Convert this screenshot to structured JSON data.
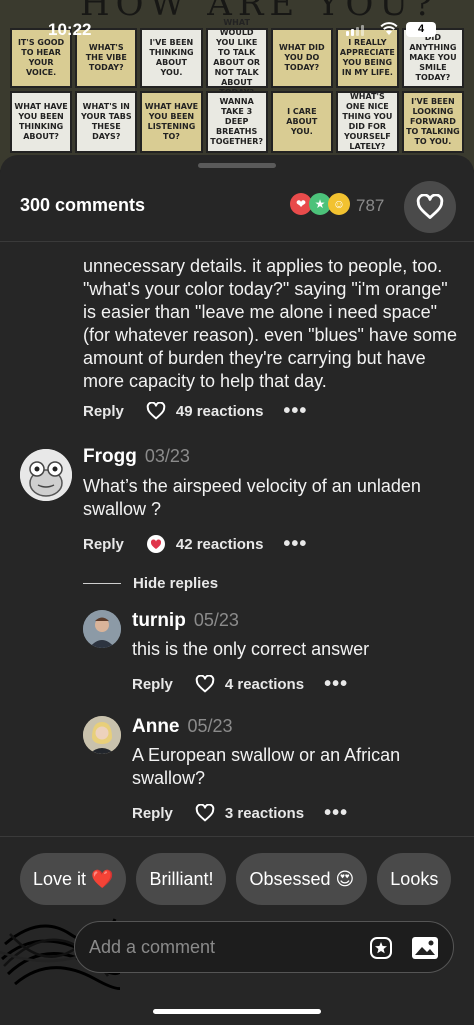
{
  "status_bar": {
    "time": "10:22",
    "battery": "4"
  },
  "background_image": {
    "banner": "HOW ARE YOU?",
    "cards_row1": [
      "IT'S GOOD TO HEAR YOUR VOICE.",
      "WHAT'S THE VIBE TODAY?",
      "I'VE BEEN THINKING ABOUT YOU.",
      "WHAT WOULD YOU LIKE TO TALK ABOUT OR NOT TALK ABOUT TODAY?",
      "WHAT DID YOU DO TODAY?",
      "I REALLY APPRECIATE YOU BEING IN MY LIFE.",
      "DID ANYTHING MAKE YOU SMILE TODAY?"
    ],
    "cards_row2": [
      "WHAT HAVE YOU BEEN THINKING ABOUT?",
      "WHAT'S IN YOUR TABS THESE DAYS?",
      "WHAT HAVE YOU BEEN LISTENING TO?",
      "WANNA TAKE 3 DEEP BREATHS TOGETHER?",
      "I CARE ABOUT YOU.",
      "WHAT'S ONE NICE THING YOU DID FOR YOURSELF LATELY?",
      "I'VE BEEN LOOKING FORWARD TO TALKING TO YOU."
    ]
  },
  "sheet": {
    "comments_count": "300 comments",
    "reactions_total": "787",
    "reaction_emojis": [
      "red-heart-eyes",
      "green-star-eyes",
      "yellow-halo-face"
    ]
  },
  "comments": [
    {
      "text": "unnecessary details. it applies to people, too. \"what's your color today?\" saying \"i'm orange\" is easier than \"leave me alone i need space\" (for whatever reason). even \"blues\" have some amount of burden they're carrying but have more capacity to help that day.",
      "reply_label": "Reply",
      "reactions": "49 reactions"
    },
    {
      "author": "Frogg",
      "date": "03/23",
      "text": "What’s the airspeed velocity of an unladen swallow ?",
      "reply_label": "Reply",
      "reactions": "42 reactions"
    }
  ],
  "hide_replies": "Hide replies",
  "replies": [
    {
      "author": "turnip",
      "date": "05/23",
      "text": "this is the only correct answer",
      "reply_label": "Reply",
      "reactions": "4 reactions"
    },
    {
      "author": "Anne",
      "date": "05/23",
      "text": "A European swallow or an African swallow?",
      "reply_label": "Reply",
      "reactions": "3 reactions"
    }
  ],
  "quick_reactions": [
    "Love it ❤️",
    "Brilliant!",
    "Obsessed 😍",
    "Looks"
  ],
  "composer": {
    "placeholder": "Add a comment"
  },
  "colors": {
    "sheet_bg": "#262626",
    "chip_bg": "#4a4a4a",
    "muted_text": "#8b8b8b"
  }
}
